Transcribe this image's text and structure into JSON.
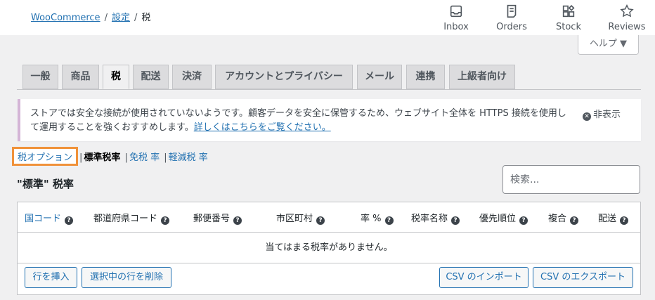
{
  "breadcrumb": {
    "root": "WooCommerce",
    "settings": "設定",
    "current": "税"
  },
  "top_actions": [
    {
      "label": "Inbox",
      "icon": "inbox-icon"
    },
    {
      "label": "Orders",
      "icon": "orders-icon"
    },
    {
      "label": "Stock",
      "icon": "stock-icon"
    },
    {
      "label": "Reviews",
      "icon": "star-icon"
    }
  ],
  "help": {
    "label": "ヘルプ ▼"
  },
  "tabs": [
    {
      "label": "一般"
    },
    {
      "label": "商品"
    },
    {
      "label": "税",
      "active": true
    },
    {
      "label": "配送"
    },
    {
      "label": "決済"
    },
    {
      "label": "アカウントとプライバシー"
    },
    {
      "label": "メール"
    },
    {
      "label": "連携"
    },
    {
      "label": "上級者向け"
    }
  ],
  "notice": {
    "text": "ストアでは安全な接続が使用されていないようです。顧客データを安全に保管するため、ウェブサイト全体を HTTPS 接続を使用して運用することを強くおすすめします。",
    "link": "詳しくはこちらをご覧ください。",
    "dismiss": "非表示"
  },
  "subnav": {
    "options": "税オプション",
    "standard": "標準税率",
    "exempt": "免税 率",
    "reduced": "軽減税 率"
  },
  "section_title": "\"標準\" 税率",
  "search": {
    "placeholder": "検索...",
    "value": ""
  },
  "table": {
    "headers": [
      "国コード",
      "都道府県コード",
      "郵便番号",
      "市区町村",
      "率 %",
      "税率名称",
      "優先順位",
      "複合",
      "配送"
    ],
    "empty_message": "当てはまる税率がありません。"
  },
  "buttons": {
    "insert_row": "行を挿入",
    "delete_selected": "選択中の行を削除",
    "import_csv": "CSV のインポート",
    "export_csv": "CSV のエクスポート"
  },
  "colors": {
    "link": "#2271b1",
    "highlight": "#f0923a",
    "notice_border": "#d4b5d6"
  }
}
